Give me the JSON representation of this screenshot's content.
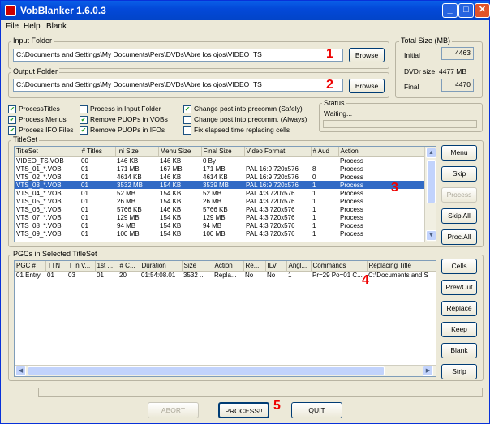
{
  "window": {
    "title": "VobBlanker 1.6.0.3",
    "min": "_",
    "max": "□",
    "close": "✕"
  },
  "menu": [
    "File",
    "Help",
    "Blank"
  ],
  "input_folder": {
    "label": "Input Folder",
    "value": "C:\\Documents and Settings\\My Documents\\Pers\\DVDs\\Abre los ojos\\VIDEO_TS",
    "browse": "Browse"
  },
  "output_folder": {
    "label": "Output Folder",
    "value": "C:\\Documents and Settings\\My Documents\\Pers\\DVDs\\Abre los ojos\\VIDEO_TS",
    "browse": "Browse"
  },
  "total_size": {
    "label": "Total Size (MB)",
    "initial_label": "Initial",
    "initial_value": "4463",
    "dvdr_label": "DVDr size: 4477 MB",
    "final_label": "Final",
    "final_value": "4470"
  },
  "options": {
    "col1": [
      {
        "label": "ProcessTitles",
        "checked": true
      },
      {
        "label": "Process Menus",
        "checked": true
      },
      {
        "label": "Process IFO Files",
        "checked": true
      }
    ],
    "col2": [
      {
        "label": "Process in Input Folder",
        "checked": false
      },
      {
        "label": "Remove PUOPs in VOBs",
        "checked": true
      },
      {
        "label": "Remove PUOPs in IFOs",
        "checked": true
      }
    ],
    "col3": [
      {
        "label": "Change post into precomm (Safely)",
        "checked": true
      },
      {
        "label": "Change post into precomm. (Always)",
        "checked": false
      },
      {
        "label": "Fix elapsed time replacing cells",
        "checked": false
      }
    ]
  },
  "status": {
    "label": "Status",
    "text": "Waiting..."
  },
  "titleset": {
    "label": "TitleSet",
    "columns": [
      "TitleSet",
      "# Titles",
      "Ini Size",
      "Menu Size",
      "Final Size",
      "Video Format",
      "# Aud",
      "Action"
    ],
    "rows": [
      [
        "VIDEO_TS.VOB",
        "00",
        "146 KB",
        "146 KB",
        "0 By",
        "",
        "",
        "Process"
      ],
      [
        "VTS_01_*.VOB",
        "01",
        "171 MB",
        "167 MB",
        "171 MB",
        "PAL 16:9 720x576",
        "8",
        "Process"
      ],
      [
        "VTS_02_*.VOB",
        "01",
        "4614 KB",
        "146 KB",
        "4614 KB",
        "PAL 16:9 720x576",
        "0",
        "Process"
      ],
      [
        "VTS_03_*.VOB",
        "01",
        "3532 MB",
        "154 KB",
        "3539 MB",
        "PAL 16:9 720x576",
        "1",
        "Process"
      ],
      [
        "VTS_04_*.VOB",
        "01",
        "52 MB",
        "154 KB",
        "52 MB",
        "PAL 4:3 720x576",
        "1",
        "Process"
      ],
      [
        "VTS_05_*.VOB",
        "01",
        "26 MB",
        "154 KB",
        "26 MB",
        "PAL 4:3 720x576",
        "1",
        "Process"
      ],
      [
        "VTS_06_*.VOB",
        "01",
        "5766 KB",
        "146 KB",
        "5766 KB",
        "PAL 4:3 720x576",
        "1",
        "Process"
      ],
      [
        "VTS_07_*.VOB",
        "01",
        "129 MB",
        "154 KB",
        "129 MB",
        "PAL 4:3 720x576",
        "1",
        "Process"
      ],
      [
        "VTS_08_*.VOB",
        "01",
        "94 MB",
        "154 KB",
        "94 MB",
        "PAL 4:3 720x576",
        "1",
        "Process"
      ],
      [
        "VTS_09_*.VOB",
        "01",
        "100 MB",
        "154 KB",
        "100 MB",
        "PAL 4:3 720x576",
        "1",
        "Process"
      ]
    ],
    "selected_row": 3,
    "buttons": [
      {
        "label": "Menu",
        "enabled": true
      },
      {
        "label": "Skip",
        "enabled": true
      },
      {
        "label": "Process",
        "enabled": false
      },
      {
        "label": "Skip All",
        "enabled": true
      },
      {
        "label": "Proc.All",
        "enabled": true
      }
    ]
  },
  "pgcs": {
    "label": "PGCs in Selected TitleSet",
    "columns": [
      "PGC #",
      "TTN",
      "T in V...",
      "1st ...",
      "# C...",
      "Duration",
      "Size",
      "Action",
      "Re...",
      "ILV",
      "Angl...",
      "Commands",
      "Replacing Title"
    ],
    "rows": [
      [
        "01 Entry",
        "01",
        "03",
        "01",
        "20",
        "01:54:08.01",
        "3532 ...",
        "Repla...",
        "No",
        "No",
        "1",
        "Pr=29 Po=01 C...",
        "C:\\Documents and S"
      ]
    ],
    "buttons": [
      "Cells",
      "Prev/Cut",
      "Replace",
      "Keep",
      "Blank",
      "Strip"
    ]
  },
  "bottom": {
    "abort": "ABORT",
    "process": "PROCESS!!",
    "quit": "QUIT"
  },
  "annotations": [
    "1",
    "2",
    "3",
    "4",
    "5"
  ]
}
